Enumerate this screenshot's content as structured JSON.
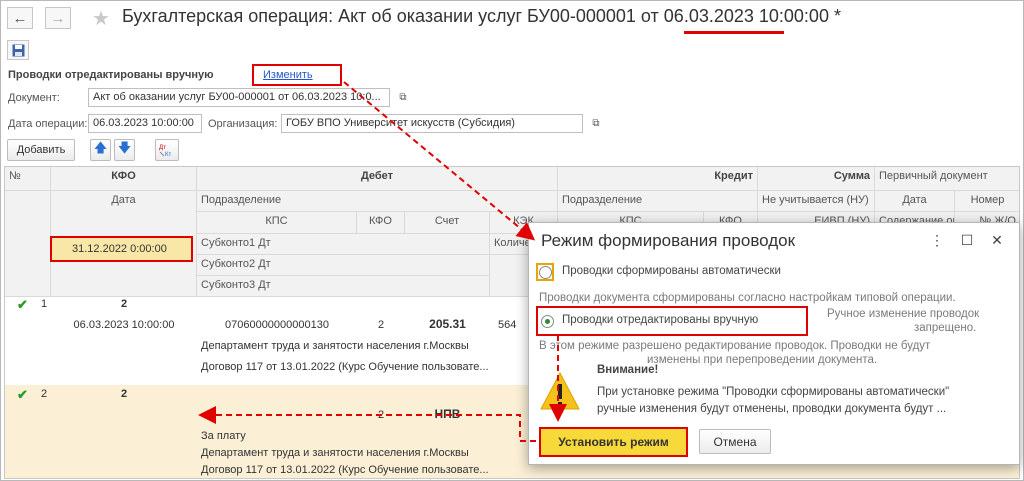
{
  "window": {
    "title": "Бухгалтерская операция: Акт об оказании услуг БУ00-000001 от 06.03.2023 10:00:00 *"
  },
  "toolbar": {
    "back": "←",
    "forward": "→",
    "favorite": "★"
  },
  "status": {
    "edited_label": "Проводки отредактированы вручную",
    "change_link": "Изменить"
  },
  "form": {
    "document_label": "Документ:",
    "document_value": "Акт об оказании услуг БУ00-000001 от 06.03.2023 10:0...",
    "date_label": "Дата операции:",
    "date_value": "06.03.2023 10:00:00",
    "org_label": "Организация:",
    "org_value": "ГОБУ ВПО Университет искусств (Субсидия)",
    "add_button": "Добавить"
  },
  "grid": {
    "headers": {
      "num": "№",
      "kfo": "КФО",
      "debit": "Дебет",
      "credit": "Кредит",
      "sum": "Сумма",
      "primary": "Первичный документ",
      "date": "Дата",
      "subdivision_dt": "Подразделение",
      "subdivision_kt": "Подразделение",
      "not_counted": "Не учитывается (НУ)",
      "pd_date": "Дата",
      "pd_number": "Номер",
      "kps": "КПС",
      "kfo2": "КФО",
      "account": "Счет",
      "kek": "КЭК",
      "qty": "Количе",
      "sub1": "Субконто1 Дт",
      "sub2": "Субконто2 Дт",
      "sub3": "Субконто3 Дт",
      "kps_kt": "КПС",
      "kfo_kt": "КФО",
      "kt_extra": "ЕИВП (НУ)",
      "kt_extra2": "Содержание опер",
      "kt_extra3": "№ Ж/О"
    },
    "rows": [
      {
        "num": "1",
        "kfo": "2",
        "date": "06.03.2023 10:00:00",
        "kps": "07060000000000130",
        "kfo2": "2",
        "account": "205.31",
        "kek": "564",
        "sub1": "Департамент труда и занятости населения г.Москвы",
        "sub2": "Договор 117 от 13.01.2022 (Курс Обучение пользовате...",
        "check": "✔"
      },
      {
        "num": "2",
        "kfo": "2",
        "date": "31.12.2022 0:00:00",
        "kfo2": "2",
        "account": "НПВ",
        "sub0": "За плату",
        "sub1": "Департамент труда и занятости населения г.Москвы",
        "sub2": "Договор 117 от 13.01.2022 (Курс Обучение пользовате...",
        "check": "✔"
      }
    ]
  },
  "dialog": {
    "title": "Режим формирования проводок",
    "menu": "⋮",
    "maximize": "☐",
    "close": "✕",
    "option_auto": "Проводки сформированы автоматически",
    "auto_desc": "Проводки документа сформированы согласно настройкам типовой операции.",
    "option_manual": "Проводки отредактированы вручную",
    "manual_note_1": "Ручное изменение проводок",
    "manual_note_2": "запрещено.",
    "manual_desc_1": "В этом режиме разрешено редактирование проводок. Проводки не будут",
    "manual_desc_2": "изменены при перепроведении документа.",
    "warning_title": "Внимание!",
    "warning_1": "При установке режима \"Проводки сформированы автоматически\"",
    "warning_2": "ручные изменения будут отменены, проводки документа будут ...",
    "set_button": "Установить режим",
    "cancel_button": "Отмена"
  },
  "colors": {
    "annotation_red": "#e10000",
    "primary_button": "#f7d93a",
    "selected_row": "#fbf0d6",
    "link": "#2157c8"
  }
}
